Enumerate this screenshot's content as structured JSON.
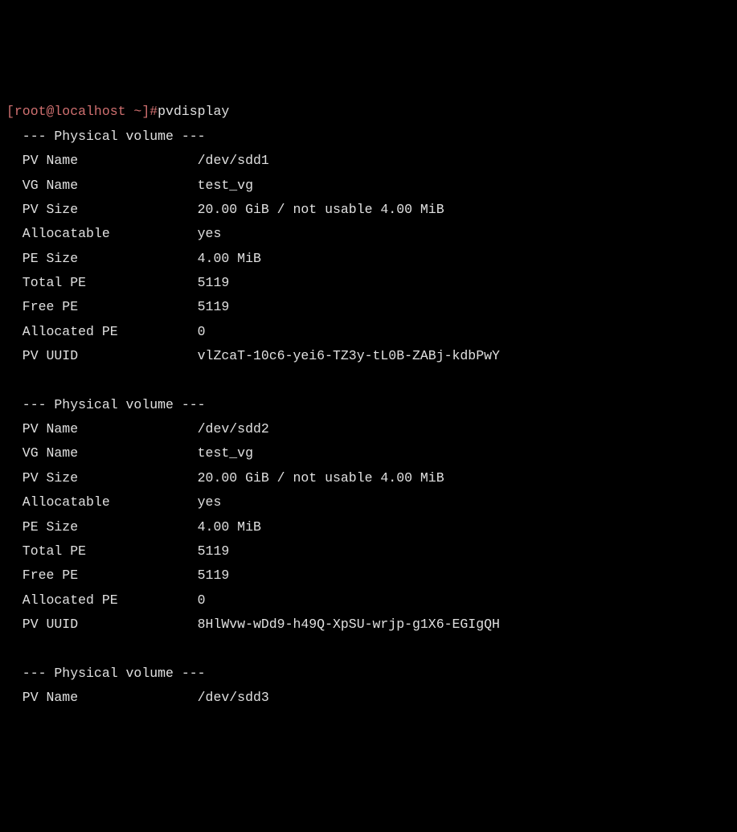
{
  "prompt_user_host": "[root@localhost ~]#",
  "command": "pvdisplay",
  "section_header": "  --- Physical volume ---",
  "labels": {
    "pv_name": "  PV Name",
    "vg_name": "  VG Name",
    "pv_size": "  PV Size",
    "allocatable": "  Allocatable",
    "pe_size": "  PE Size",
    "total_pe": "  Total PE",
    "free_pe": "  Free PE",
    "allocated_pe": "  Allocated PE",
    "pv_uuid": "  PV UUID"
  },
  "volumes": [
    {
      "pv_name": "/dev/sdd1",
      "vg_name": "test_vg",
      "pv_size": "20.00 GiB / not usable 4.00 MiB",
      "allocatable": "yes",
      "pe_size": "4.00 MiB",
      "total_pe": "5119",
      "free_pe": "5119",
      "allocated_pe": "0",
      "pv_uuid": "vlZcaT-10c6-yei6-TZ3y-tL0B-ZABj-kdbPwY"
    },
    {
      "pv_name": "/dev/sdd2",
      "vg_name": "test_vg",
      "pv_size": "20.00 GiB / not usable 4.00 MiB",
      "allocatable": "yes",
      "pe_size": "4.00 MiB",
      "total_pe": "5119",
      "free_pe": "5119",
      "allocated_pe": "0",
      "pv_uuid": "8HlWvw-wDd9-h49Q-XpSU-wrjp-g1X6-EGIgQH"
    },
    {
      "pv_name": "/dev/sdd3"
    }
  ]
}
